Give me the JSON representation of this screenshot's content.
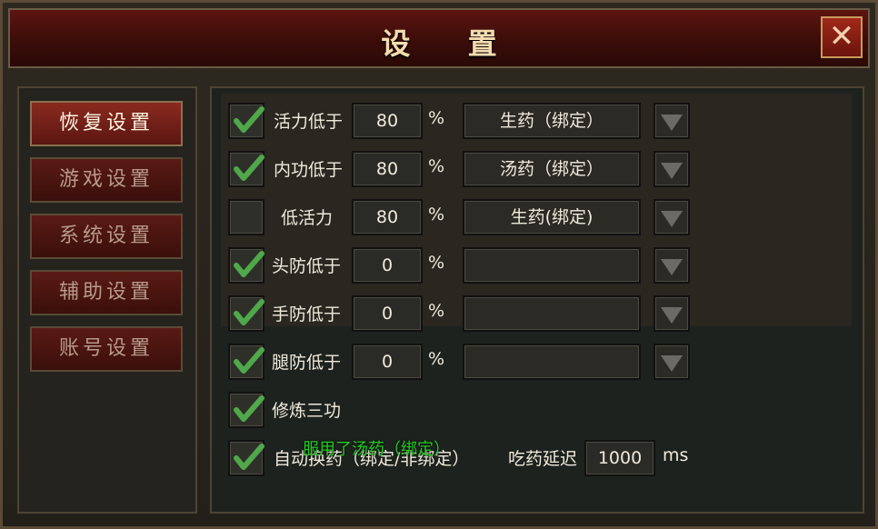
{
  "window": {
    "title": "设 置",
    "close_icon": "close-icon"
  },
  "sidebar": {
    "items": [
      {
        "label": "恢复设置",
        "active": true
      },
      {
        "label": "游戏设置",
        "active": false
      },
      {
        "label": "系统设置",
        "active": false
      },
      {
        "label": "辅助设置",
        "active": false
      },
      {
        "label": "账号设置",
        "active": false
      }
    ]
  },
  "recovery": {
    "rows": [
      {
        "checked": true,
        "label": "活力低于",
        "value": "80",
        "unit": "%",
        "item": "生药（绑定）"
      },
      {
        "checked": true,
        "label": "内功低于",
        "value": "80",
        "unit": "%",
        "item": "汤药（绑定）"
      },
      {
        "checked": false,
        "label": "低活力",
        "value": "80",
        "unit": "%",
        "item": "生药(绑定)"
      },
      {
        "checked": true,
        "label": "头防低于",
        "value": "0",
        "unit": "%",
        "item": ""
      },
      {
        "checked": true,
        "label": "手防低于",
        "value": "0",
        "unit": "%",
        "item": ""
      },
      {
        "checked": true,
        "label": "腿防低于",
        "value": "0",
        "unit": "%",
        "item": ""
      }
    ],
    "cultivate": {
      "checked": true,
      "label": "修炼三功"
    },
    "auto_switch": {
      "checked": true,
      "label": "自动换药（绑定/非绑定）",
      "delay_label": "吃药延迟",
      "delay_value": "1000",
      "delay_unit": "ms"
    },
    "toast": "服用了汤药（绑定）"
  },
  "colors": {
    "check": "#4fa84a",
    "toast": "#22cc22",
    "accent": "#6a140c"
  }
}
